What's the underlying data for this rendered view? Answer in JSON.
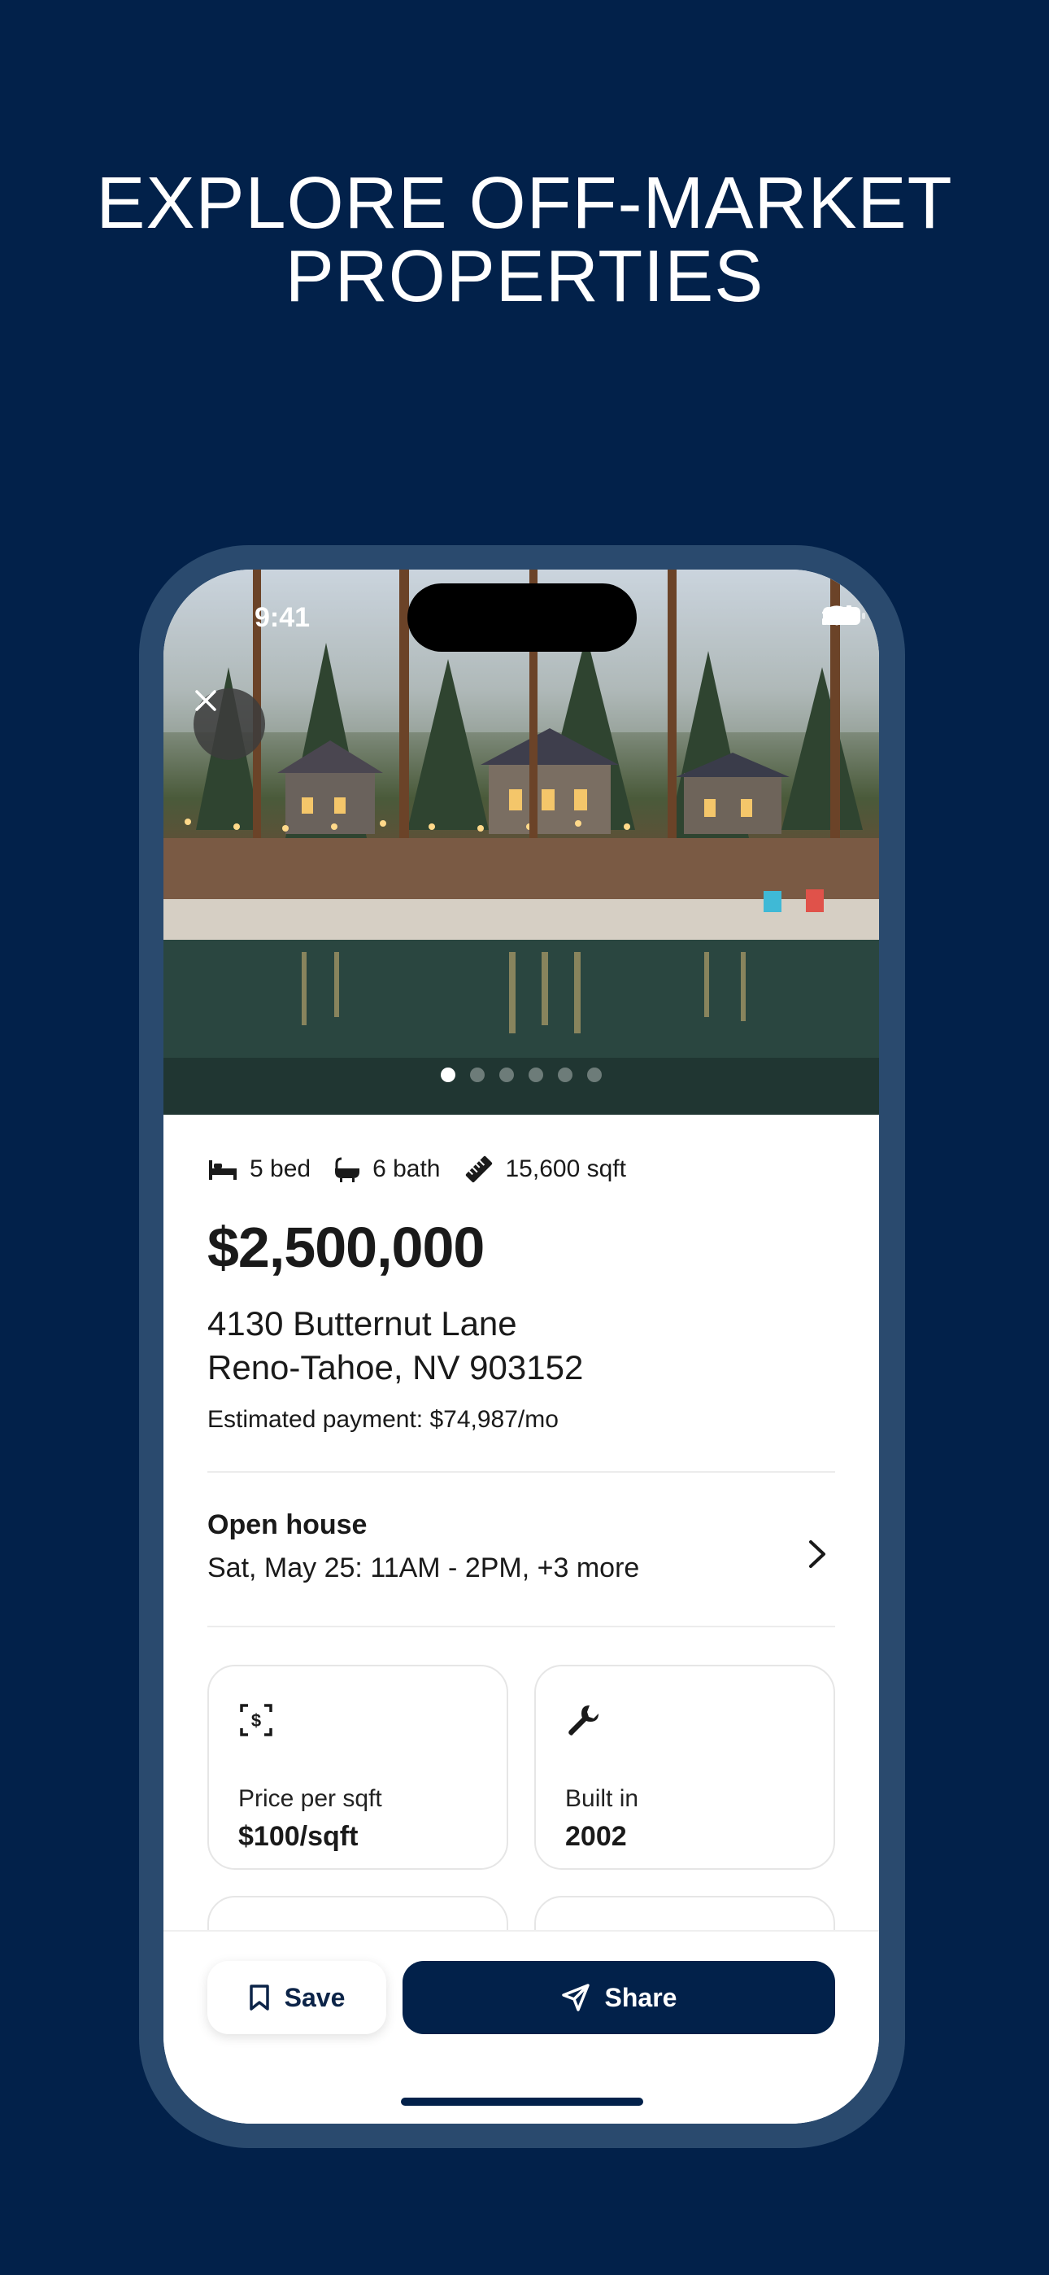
{
  "headline": {
    "line1": "EXPLORE OFF-MARKET",
    "line2": "PROPERTIES"
  },
  "status_bar": {
    "time": "9:41"
  },
  "gallery": {
    "photo_count": 6,
    "active_index": 0
  },
  "specs": {
    "beds": "5 bed",
    "baths": "6 bath",
    "area": "15,600 sqft"
  },
  "listing": {
    "price": "$2,500,000",
    "address_line1": "4130 Butternut Lane",
    "address_line2": "Reno-Tahoe, NV 903152",
    "estimated_payment": "Estimated payment: $74,987/mo"
  },
  "open_house": {
    "title": "Open house",
    "schedule": "Sat, May 25: 11AM - 2PM, +3 more"
  },
  "facts": [
    {
      "label": "Price per sqft",
      "value": "$100/sqft",
      "icon": "dollar-scan-icon"
    },
    {
      "label": "Built in",
      "value": "2002",
      "icon": "wrench-icon"
    }
  ],
  "actions": {
    "save": "Save",
    "share": "Share"
  },
  "colors": {
    "background": "#02214a",
    "accent": "#02214a",
    "phone_frame": "#2a4a6e"
  }
}
